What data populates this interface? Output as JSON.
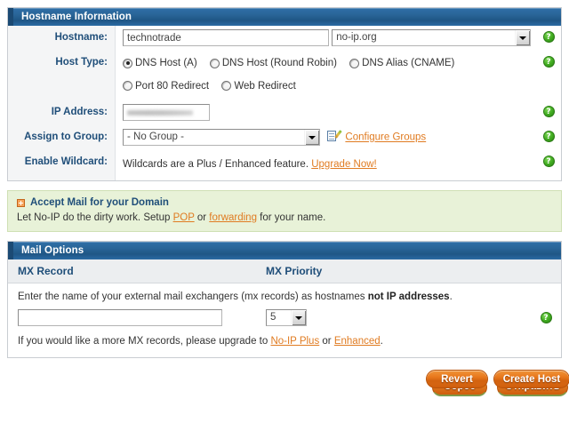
{
  "hostname_panel": {
    "title": "Hostname Information",
    "rows": {
      "hostname": {
        "label": "Hostname:",
        "value": "technotrade",
        "placeholder": "",
        "domain_selected": "no-ip.org"
      },
      "host_type": {
        "label": "Host Type:",
        "options_row1": [
          {
            "label": "DNS Host (A)",
            "checked": true
          },
          {
            "label": "DNS Host (Round Robin)",
            "checked": false
          },
          {
            "label": "DNS Alias (CNAME)",
            "checked": false
          }
        ],
        "options_row2": [
          {
            "label": "Port 80 Redirect",
            "checked": false
          },
          {
            "label": "Web Redirect",
            "checked": false
          }
        ]
      },
      "ip_address": {
        "label": "IP Address:",
        "value": ""
      },
      "assign_group": {
        "label": "Assign to Group:",
        "selected": "- No Group -",
        "configure_link": "Configure Groups"
      },
      "enable_wildcard": {
        "label": "Enable Wildcard:",
        "text": "Wildcards are a Plus / Enhanced feature.",
        "link": "Upgrade Now!"
      }
    },
    "help_icon_glyph": "?"
  },
  "accept_mail": {
    "title": "Accept Mail for your Domain",
    "sub_prefix": "Let No-IP do the dirty work. Setup ",
    "link_pop": "POP",
    "sub_mid": " or ",
    "link_forwarding": "forwarding",
    "sub_suffix": " for your name."
  },
  "mail_options": {
    "title": "Mail Options",
    "columns": {
      "mx_record": "MX Record",
      "mx_priority": "MX Priority"
    },
    "note_prefix": "Enter the name of your external mail exchangers (mx records) as hostnames ",
    "note_bold": "not IP addresses",
    "note_suffix": ".",
    "mx_record_value": "",
    "mx_priority_value": "5",
    "upgrade_prefix": "If you would like a more MX records, please upgrade to ",
    "upgrade_link1": "No-IP Plus",
    "upgrade_mid": " or ",
    "upgrade_link2": "Enhanced",
    "upgrade_suffix": "."
  },
  "buttons": {
    "revert": "Revert",
    "create_host": "Create Host",
    "revert_ru": "Сброс",
    "create_host_ru": "Отправить"
  },
  "colors": {
    "panel_header_blue": "#2a6699",
    "label_blue": "#1f4e79",
    "link_orange": "#e07b21",
    "button_orange": "#e8781d",
    "green_box_bg": "#e8f2d8",
    "help_green": "#3faa1f"
  }
}
